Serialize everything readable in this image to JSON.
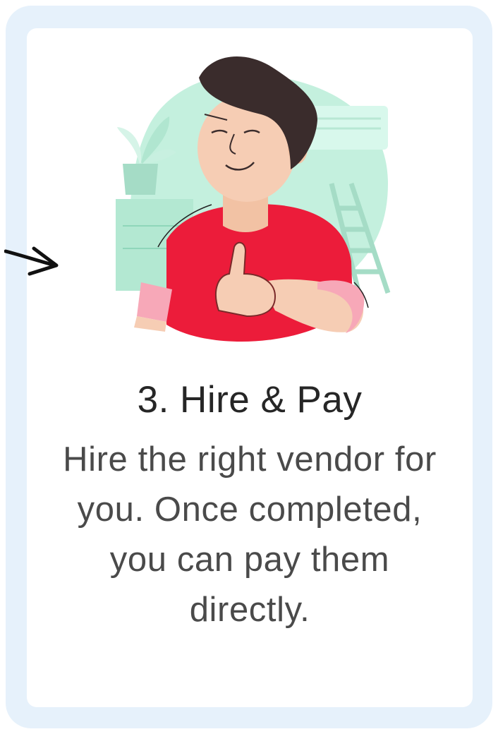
{
  "step": {
    "title": "3. Hire & Pay",
    "description": "Hire the right vendor for you. Once completed, you can pay them directly."
  },
  "icons": {
    "arrow": "arrow-right-icon",
    "illustration": "thumbs-up-person-illustration"
  },
  "colors": {
    "frame": "#e6f1fb",
    "card": "#ffffff",
    "mint": "#c4f0de",
    "shirt": "#ec1c3a",
    "skin": "#f6cdb4",
    "hair": "#3a2c2c",
    "title": "#262626",
    "text": "#4a4a4a"
  }
}
